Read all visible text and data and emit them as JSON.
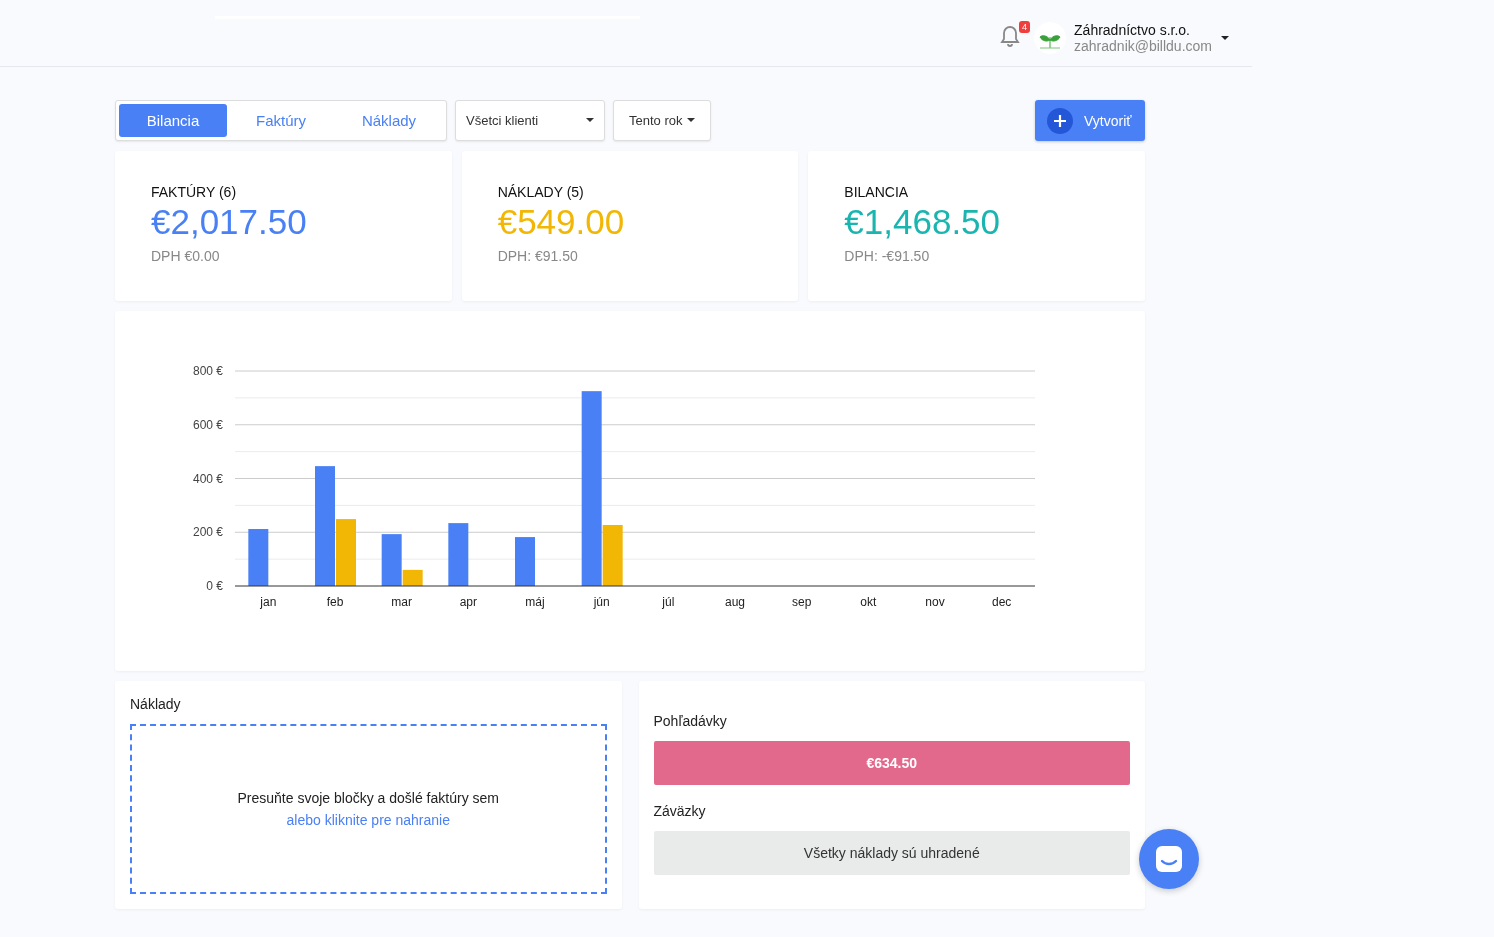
{
  "header": {
    "notifications": "4",
    "company": "Záhradníctvo s.r.o.",
    "email": "zahradnik@billdu.com"
  },
  "tabs": [
    {
      "label": "Bilancia",
      "selected": true
    },
    {
      "label": "Faktúry",
      "selected": false
    },
    {
      "label": "Náklady",
      "selected": false
    }
  ],
  "client_filter": "Všetci klienti",
  "period_filter": "Tento rok",
  "create_button": "Vytvoriť",
  "cards": [
    {
      "title": "FAKTÚRY (6)",
      "amount": "€2,017.50",
      "vat": "DPH €0.00",
      "color": "#4a80f5"
    },
    {
      "title": "NÁKLADY (5)",
      "amount": "€549.00",
      "vat": "DPH: €91.50",
      "color": "#f2b705"
    },
    {
      "title": "BILANCIA",
      "amount": "€1,468.50",
      "vat": "DPH: -€91.50",
      "color": "#1bb5b0"
    }
  ],
  "chart_data": {
    "type": "bar",
    "categories": [
      "jan",
      "feb",
      "mar",
      "apr",
      "máj",
      "jún",
      "júl",
      "aug",
      "sep",
      "okt",
      "nov",
      "dec"
    ],
    "series": [
      {
        "color": "#4a80f5",
        "values": [
          212,
          446,
          193,
          234,
          182,
          725,
          null,
          null,
          null,
          null,
          null,
          null
        ]
      },
      {
        "color": "#f2b705",
        "values": [
          null,
          249,
          60,
          null,
          null,
          227,
          null,
          null,
          null,
          null,
          null,
          null
        ]
      }
    ],
    "grid": true,
    "ylim": [
      0,
      800
    ],
    "yticks": [
      {
        "value": 0,
        "label": "0 €"
      },
      {
        "value": 200,
        "label": "200 €"
      },
      {
        "value": 400,
        "label": "400 €"
      },
      {
        "value": 600,
        "label": "600 €"
      },
      {
        "value": 800,
        "label": "800 €"
      }
    ]
  },
  "expenses": {
    "title": "Náklady",
    "drop_text": "Presuňte svoje bločky a došlé faktúry sem",
    "upload_link": "alebo kliknite pre nahranie"
  },
  "receivables": {
    "title": "Pohľadávky",
    "amount": "€634.50",
    "liabilities_title": "Záväzky",
    "liabilities_text": "Všetky náklady sú uhradené"
  }
}
